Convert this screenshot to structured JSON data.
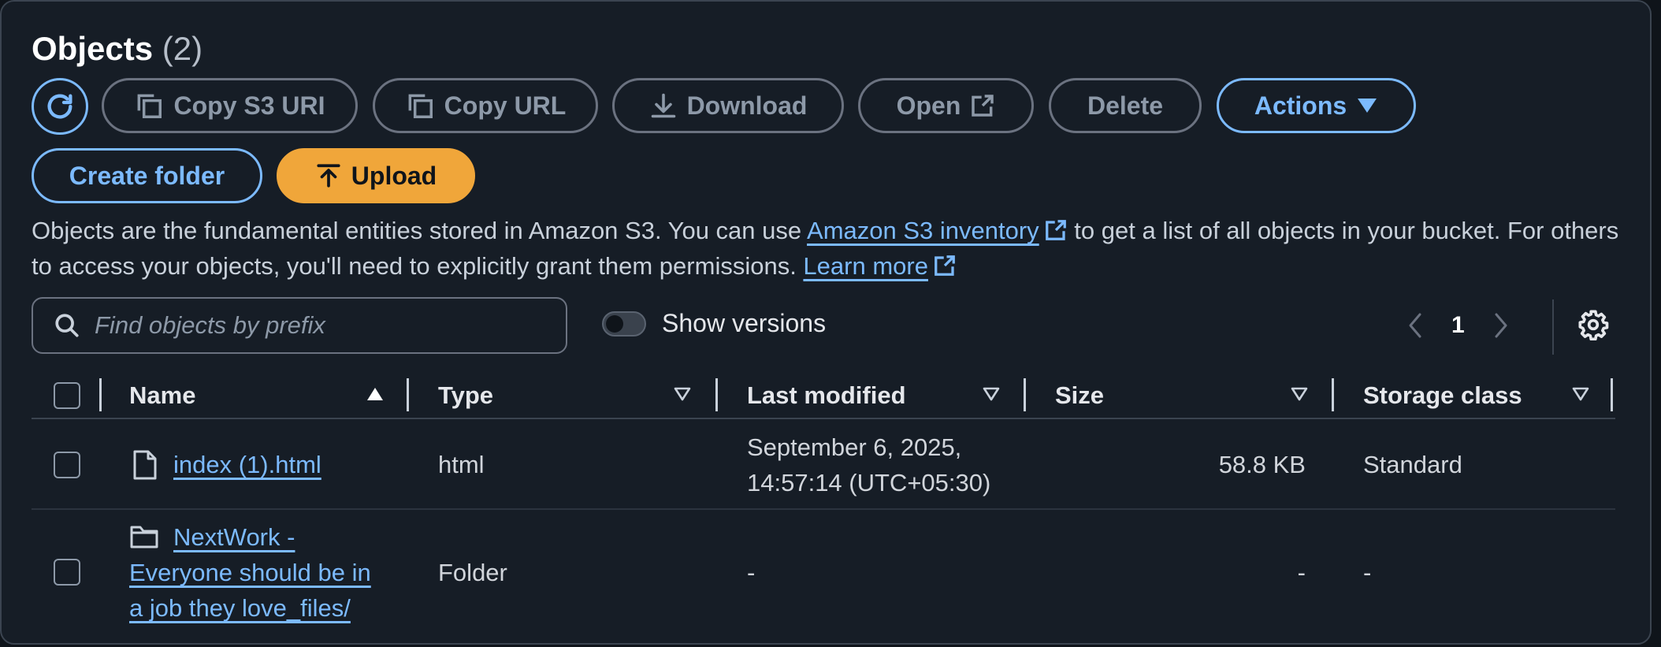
{
  "header": {
    "title": "Objects",
    "count": "(2)"
  },
  "toolbar": {
    "copy_s3_uri": "Copy S3 URI",
    "copy_url": "Copy URL",
    "download": "Download",
    "open": "Open",
    "delete": "Delete",
    "actions": "Actions",
    "create_folder": "Create folder",
    "upload": "Upload"
  },
  "description": {
    "part1": "Objects are the fundamental entities stored in Amazon S3. You can use ",
    "inventory_link": "Amazon S3 inventory",
    "part2": " to get a list of all objects in your bucket. For others to access your objects, you'll need to explicitly grant them permissions. ",
    "learn_more": "Learn more"
  },
  "search": {
    "placeholder": "Find objects by prefix"
  },
  "versions": {
    "label": "Show versions",
    "enabled": false
  },
  "pagination": {
    "current_page": "1"
  },
  "table": {
    "columns": [
      "Name",
      "Type",
      "Last modified",
      "Size",
      "Storage class"
    ],
    "rows": [
      {
        "icon": "file-icon",
        "name": "index (1).html",
        "type": "html",
        "last_modified_line1": "September 6, 2025,",
        "last_modified_line2": "14:57:14 (UTC+05:30)",
        "size": "58.8 KB",
        "storage_class": "Standard"
      },
      {
        "icon": "folder-icon",
        "name_line1": "NextWork -",
        "name_line2": "Everyone should be in",
        "name_line3": "a job they love_files/",
        "type": "Folder",
        "last_modified": "-",
        "size": "-",
        "storage_class": "-"
      }
    ]
  },
  "colors": {
    "accent": "#7cbaff",
    "upload": "#f0a63a",
    "background": "#161d26"
  }
}
